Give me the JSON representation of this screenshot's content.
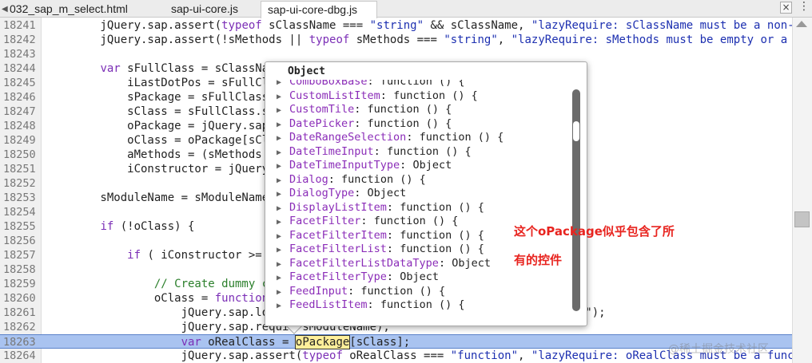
{
  "tabs": [
    {
      "label": "032_sap_m_select.html",
      "active": false
    },
    {
      "label": "sap-ui-core.js",
      "active": false
    },
    {
      "label": "sap-ui-core-dbg.js",
      "active": true
    }
  ],
  "close_symbol": "×",
  "editor": {
    "lines": [
      {
        "num": "18241",
        "html": "        jQuery.sap.assert(<span class=\"kw\">typeof</span> sClassName === <span class=\"str\">\"string\"</span> &amp;&amp; sClassName, <span class=\"str\">\"lazyRequire: sClassName must be a non-em</span>"
      },
      {
        "num": "18242",
        "html": "        jQuery.sap.assert(!sMethods || <span class=\"kw\">typeof</span> sMethods === <span class=\"str\">\"string\"</span>, <span class=\"str\">\"lazyRequire: sMethods must be empty or a st</span>"
      },
      {
        "num": "18243",
        "html": ""
      },
      {
        "num": "18244",
        "html": "        <span class=\"kw\">var</span> sFullClass = sClassNa"
      },
      {
        "num": "18245",
        "html": "            iLastDotPos = sFullCl"
      },
      {
        "num": "18246",
        "html": "            sPackage = sFullClass"
      },
      {
        "num": "18247",
        "html": "            sClass = sFullClass.s"
      },
      {
        "num": "18248",
        "html": "            oPackage = jQuery.sap"
      },
      {
        "num": "18249",
        "html": "            oClass = oPackage[sCl"
      },
      {
        "num": "18250",
        "html": "            aMethods = (sMethods "
      },
      {
        "num": "18251",
        "html": "            iConstructor = jQuery"
      },
      {
        "num": "18252",
        "html": ""
      },
      {
        "num": "18253",
        "html": "        sModuleName = sModuleName"
      },
      {
        "num": "18254",
        "html": ""
      },
      {
        "num": "18255",
        "html": "        <span class=\"kw\">if</span> (!oClass) {"
      },
      {
        "num": "18256",
        "html": ""
      },
      {
        "num": "18257",
        "html": "            <span class=\"kw\">if</span> ( iConstructor &gt;="
      },
      {
        "num": "18258",
        "html": ""
      },
      {
        "num": "18259",
        "html": "                <span class=\"cm\">// Create dummy c</span>"
      },
      {
        "num": "18260",
        "html": "                oClass = <span class=\"kw\">function</span>"
      },
      {
        "num": "18261",
        "html": "                    jQuery.sap.lo                               tructor) called.\");"
      },
      {
        "num": "18262",
        "html": "                    jQuery.sap.requi  sModuleName);"
      },
      {
        "num": "18263",
        "html": "                    <span class=\"kw\">var</span> oRealClass = <span class=\"match\">oPackage</span>[sClass];",
        "highlight": true
      },
      {
        "num": "18264",
        "html": "                    jQuery.sap.assert(<span class=\"kw\">typeof</span> oRealClass === <span class=\"str\">\"function\"</span>, <span class=\"str\">\"lazyRequire: oRealClass must be a functi</span>"
      }
    ]
  },
  "popup": {
    "title": "Object",
    "items": [
      {
        "name": "ComboBoxBase",
        "value": "function () {"
      },
      {
        "name": "CustomListItem",
        "value": "function () {"
      },
      {
        "name": "CustomTile",
        "value": "function () {"
      },
      {
        "name": "DatePicker",
        "value": "function () {"
      },
      {
        "name": "DateRangeSelection",
        "value": "function () {"
      },
      {
        "name": "DateTimeInput",
        "value": "function () {"
      },
      {
        "name": "DateTimeInputType",
        "value": "Object"
      },
      {
        "name": "Dialog",
        "value": "function () {"
      },
      {
        "name": "DialogType",
        "value": "Object"
      },
      {
        "name": "DisplayListItem",
        "value": "function () {"
      },
      {
        "name": "FacetFilter",
        "value": "function () {"
      },
      {
        "name": "FacetFilterItem",
        "value": "function () {"
      },
      {
        "name": "FacetFilterList",
        "value": "function () {"
      },
      {
        "name": "FacetFilterListDataType",
        "value": "Object"
      },
      {
        "name": "FacetFilterType",
        "value": "Object"
      },
      {
        "name": "FeedInput",
        "value": "function () {"
      },
      {
        "name": "FeedListItem",
        "value": "function () {"
      }
    ]
  },
  "annotation": {
    "line1": "这个oPackage似乎包含了所",
    "line2": "有的控件"
  },
  "watermark": "@稀土掘金技术社区",
  "colors": {
    "annotation": "#e8241f",
    "highlight_line": "#a9c3f0",
    "keyword": "#7b2eb6",
    "string": "#1c2fb0",
    "comment": "#2b7f2b"
  }
}
